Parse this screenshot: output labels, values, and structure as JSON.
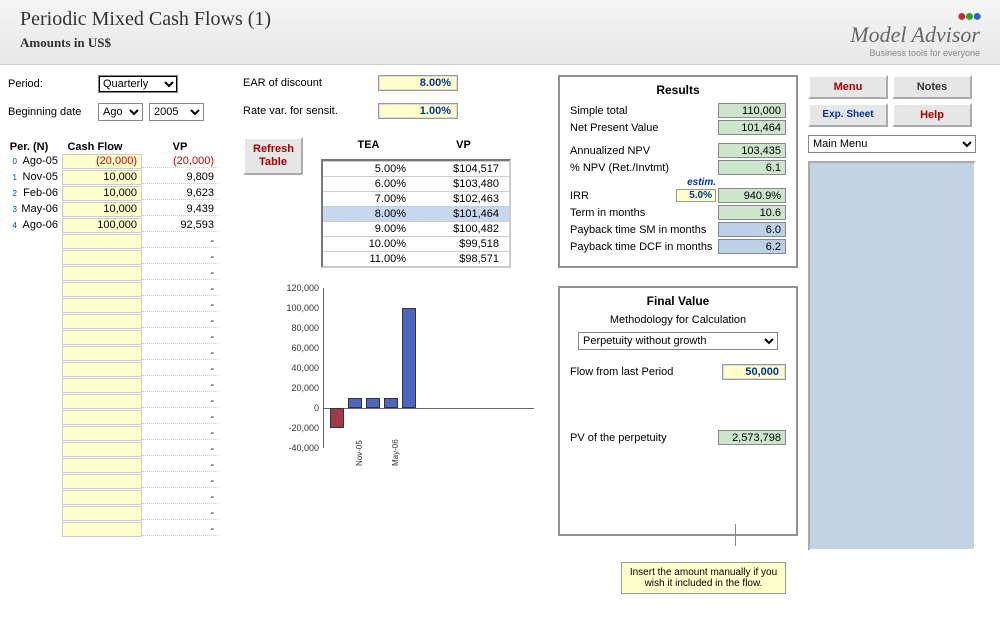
{
  "header": {
    "title": "Periodic Mixed Cash Flows (1)",
    "subtitle": "Amounts in US$",
    "logo_name": "Model Advisor",
    "logo_tag": "Business tools for everyone"
  },
  "params": {
    "period_label": "Period:",
    "period_value": "Quarterly",
    "begdate_label": "Beginning date",
    "begdate_month": "Ago",
    "begdate_year": "2005",
    "ear_label": "EAR of discount",
    "ear_value": "8.00%",
    "sensit_label": "Rate var. for sensit.",
    "sensit_value": "1.00%"
  },
  "flows_header": {
    "per": "Per. (N)",
    "cf": "Cash Flow",
    "vp": "VP"
  },
  "flows": [
    {
      "idx": "0",
      "per": "Ago-05",
      "cf": "(20,000)",
      "vp": "(20,000)",
      "neg": true
    },
    {
      "idx": "1",
      "per": "Nov-05",
      "cf": "10,000",
      "vp": "9,809"
    },
    {
      "idx": "2",
      "per": "Feb-06",
      "cf": "10,000",
      "vp": "9,623"
    },
    {
      "idx": "3",
      "per": "May-06",
      "cf": "10,000",
      "vp": "9,439"
    },
    {
      "idx": "4",
      "per": "Ago-06",
      "cf": "100,000",
      "vp": "92,593"
    }
  ],
  "empty_rows": 19,
  "refresh_label": "Refresh Table",
  "sens_header": {
    "tea": "TEA",
    "vp": "VP"
  },
  "sens": [
    {
      "tea": "5.00%",
      "vp": "$104,517"
    },
    {
      "tea": "6.00%",
      "vp": "$103,480"
    },
    {
      "tea": "7.00%",
      "vp": "$102,463"
    },
    {
      "tea": "8.00%",
      "vp": "$101,464",
      "hl": true
    },
    {
      "tea": "9.00%",
      "vp": "$100,482"
    },
    {
      "tea": "10.00%",
      "vp": "$99,518"
    },
    {
      "tea": "11.00%",
      "vp": "$98,571"
    }
  ],
  "results": {
    "title": "Results",
    "rows": [
      {
        "label": "Simple total",
        "value": "110,000",
        "cls": ""
      },
      {
        "label": "Net Present Value",
        "value": "101,464",
        "cls": ""
      },
      {
        "label": "Annualized NPV",
        "value": "103,435",
        "cls": "",
        "gap_after": false
      },
      {
        "label": "% NPV (Ret./Invtmt)",
        "value": "6.1",
        "cls": ""
      }
    ],
    "estim_label": "estim.",
    "irr_label": "IRR",
    "irr_est": "5.0%",
    "irr_value": "940.9%",
    "rows2": [
      {
        "label": "Term in months",
        "value": "10.6",
        "cls": ""
      },
      {
        "label": "Payback time SM in months",
        "value": "6.0",
        "cls": "blue"
      },
      {
        "label": "Payback time DCF in months",
        "value": "6.2",
        "cls": "blue"
      }
    ]
  },
  "final": {
    "title": "Final Value",
    "subtitle": "Methodology for Calculation",
    "method": "Perpetuity without growth",
    "flow_label": "Flow from last Period",
    "flow_value": "50,000",
    "pv_label": "PV of the perpetuity",
    "pv_value": "2,573,798",
    "tooltip": "Insert the amount manually if you wish it included in the flow."
  },
  "side": {
    "menu": "Menu",
    "notes": "Notes",
    "exp": "Exp. Sheet",
    "help": "Help",
    "main_menu": "Main Menu"
  },
  "chart_data": {
    "type": "bar",
    "categories": [
      "Ago-05",
      "Nov-05",
      "Feb-06",
      "May-06",
      "Ago-06"
    ],
    "values": [
      -20000,
      10000,
      10000,
      10000,
      100000
    ],
    "ylim": [
      -40000,
      120000
    ],
    "yticks": [
      -40000,
      -20000,
      0,
      20000,
      40000,
      60000,
      80000,
      100000,
      120000
    ],
    "ytick_labels": [
      "-40,000",
      "-20,000",
      "0",
      "20,000",
      "40,000",
      "60,000",
      "80,000",
      "100,000",
      "120,000"
    ],
    "xtick_labels": [
      "Nov-05",
      "May-06"
    ]
  }
}
